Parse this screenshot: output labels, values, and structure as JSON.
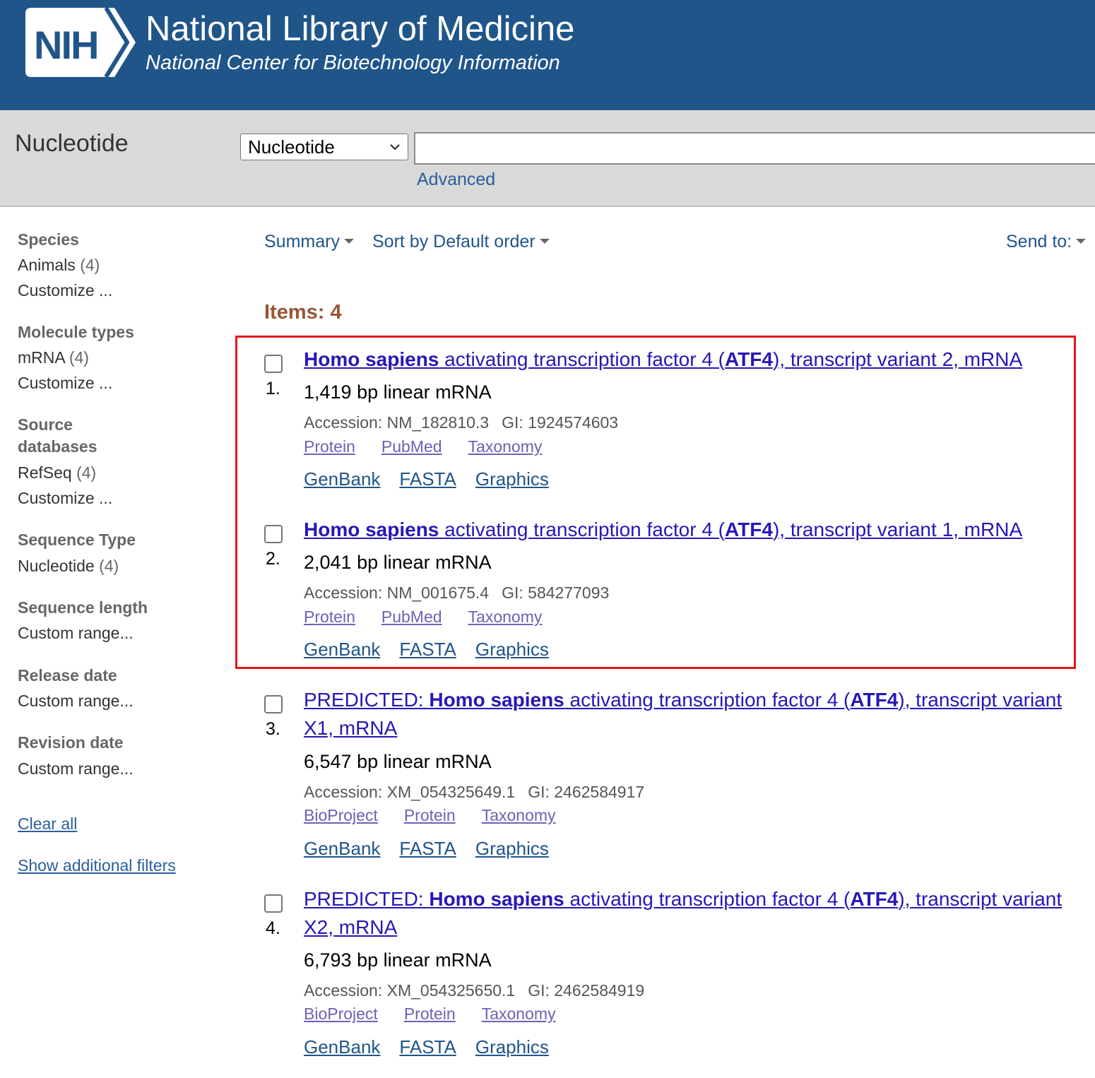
{
  "header": {
    "logo_text": "NIH",
    "title": "National Library of Medicine",
    "subtitle": "National Center for Biotechnology Information"
  },
  "search": {
    "db_title": "Nucleotide",
    "db_selected": "Nucleotide",
    "query": "",
    "advanced_label": "Advanced"
  },
  "sidebar": {
    "species_heading": "Species",
    "species_item": "Animals",
    "species_count": "(4)",
    "species_customize": "Customize ...",
    "molecule_heading": "Molecule types",
    "molecule_item": "mRNA",
    "molecule_count": "(4)",
    "molecule_customize": "Customize ...",
    "source_heading_line1": "Source",
    "source_heading_line2": "databases",
    "source_item": "RefSeq",
    "source_count": "(4)",
    "source_customize": "Customize ...",
    "seqtype_heading": "Sequence Type",
    "seqtype_item": "Nucleotide",
    "seqtype_count": "(4)",
    "seqlen_heading": "Sequence length",
    "seqlen_item": "Custom range...",
    "release_heading": "Release date",
    "release_item": "Custom range...",
    "revision_heading": "Revision date",
    "revision_item": "Custom range...",
    "clear_all": "Clear all",
    "show_filters": "Show additional filters"
  },
  "toolbar": {
    "summary": "Summary",
    "sort": "Sort by Default order",
    "send_to": "Send to:"
  },
  "items_count": "Items: 4",
  "results": [
    {
      "num": "1.",
      "prefix": "",
      "species": "Homo sapiens",
      "t1": " activating transcription factor 4 (",
      "gene": "ATF4",
      "t2": "), transcript variant 2, mRNA",
      "desc": "1,419 bp linear mRNA",
      "accession": "Accession: NM_182810.3",
      "gi": "GI: 1924574603",
      "links": [
        "Protein",
        "PubMed",
        "Taxonomy"
      ],
      "links2": [
        "GenBank",
        "FASTA",
        "Graphics"
      ]
    },
    {
      "num": "2.",
      "prefix": "",
      "species": "Homo sapiens",
      "t1": " activating transcription factor 4 (",
      "gene": "ATF4",
      "t2": "), transcript variant 1, mRNA",
      "desc": "2,041 bp linear mRNA",
      "accession": "Accession: NM_001675.4",
      "gi": "GI: 584277093",
      "links": [
        "Protein",
        "PubMed",
        "Taxonomy"
      ],
      "links2": [
        "GenBank",
        "FASTA",
        "Graphics"
      ]
    },
    {
      "num": "3.",
      "prefix": "PREDICTED: ",
      "species": "Homo sapiens",
      "t1": " activating transcription factor 4 (",
      "gene": "ATF4",
      "t2": "), transcript variant X1, mRNA",
      "desc": "6,547 bp linear mRNA",
      "accession": "Accession: XM_054325649.1",
      "gi": "GI: 2462584917",
      "links": [
        "BioProject",
        "Protein",
        "Taxonomy"
      ],
      "links2": [
        "GenBank",
        "FASTA",
        "Graphics"
      ]
    },
    {
      "num": "4.",
      "prefix": "PREDICTED: ",
      "species": "Homo sapiens",
      "t1": " activating transcription factor 4 (",
      "gene": "ATF4",
      "t2": "), transcript variant X2, mRNA",
      "desc": "6,793 bp linear mRNA",
      "accession": "Accession: XM_054325650.1",
      "gi": "GI: 2462584919",
      "links": [
        "BioProject",
        "Protein",
        "Taxonomy"
      ],
      "links2": [
        "GenBank",
        "FASTA",
        "Graphics"
      ]
    }
  ],
  "colors": {
    "header_bg": "#20558a",
    "search_bg": "#d9d9d9",
    "title_link": "#2518b5",
    "items_count": "#985735",
    "highlight_border": "#e8141b"
  },
  "icons": {
    "logo": "nih-logo-icon",
    "select": "chevron-down-icon",
    "dropdown": "caret-down-icon"
  }
}
